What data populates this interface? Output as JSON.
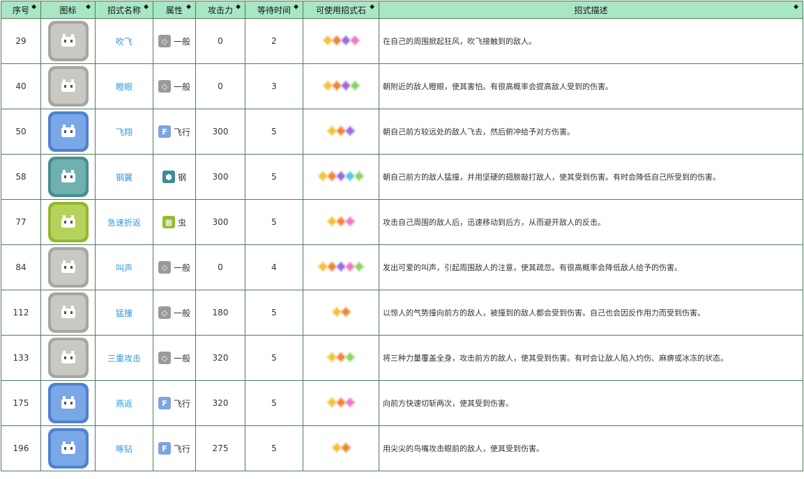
{
  "headers": [
    "序号",
    "图标",
    "招式名称",
    "属性",
    "攻击力",
    "等待时间",
    "可使用招式石",
    "招式描述"
  ],
  "sort_glyph": "◆",
  "rows": [
    {
      "id": "29",
      "name": "吹飞",
      "attr": "一般",
      "attr_type": "normal",
      "atk": "0",
      "wait": "2",
      "stones": [
        "#f2c43d",
        "#f0883a",
        "#9b6ee0",
        "#ee7cc8"
      ],
      "icon": "general",
      "desc": "在自己的周围掀起狂风，吹飞接触到的敌人。"
    },
    {
      "id": "40",
      "name": "瞪眼",
      "attr": "一般",
      "attr_type": "normal",
      "atk": "0",
      "wait": "3",
      "stones": [
        "#f2c43d",
        "#f0883a",
        "#9b6ee0",
        "#8fd46a"
      ],
      "icon": "general",
      "desc": "朝附近的敌人瞪眼，使其害怕。有很高概率会提高敌人受到的伤害。"
    },
    {
      "id": "50",
      "name": "飞翔",
      "attr": "飞行",
      "attr_type": "flying",
      "atk": "300",
      "wait": "5",
      "stones": [
        "#f2c43d",
        "#f0883a",
        "#9b6ee0"
      ],
      "icon": "flying",
      "desc": "朝自己前方较远处的敌人飞去，然后俯冲给予对方伤害。"
    },
    {
      "id": "58",
      "name": "钢翼",
      "attr": "钢",
      "attr_type": "steel",
      "atk": "300",
      "wait": "5",
      "stones": [
        "#f2c43d",
        "#f0883a",
        "#9b6ee0",
        "#5cc8e0",
        "#8fd46a"
      ],
      "icon": "steel",
      "desc": "朝自己前方的敌人猛撞，并用坚硬的翅膀敲打敌人，使其受到伤害。有时会降低自己所受到的伤害。"
    },
    {
      "id": "77",
      "name": "急速折返",
      "attr": "虫",
      "attr_type": "bug",
      "atk": "300",
      "wait": "5",
      "stones": [
        "#f2c43d",
        "#f0883a",
        "#ee7cc8"
      ],
      "icon": "bug",
      "desc": "攻击自己周围的敌人后，迅速移动到后方，从而避开敌人的反击。"
    },
    {
      "id": "84",
      "name": "叫声",
      "attr": "一般",
      "attr_type": "normal",
      "atk": "0",
      "wait": "4",
      "stones": [
        "#f2c43d",
        "#f0883a",
        "#9b6ee0",
        "#ee7cc8",
        "#8fd46a"
      ],
      "icon": "general",
      "desc": "发出可爱的叫声，引起周围敌人的注意，使其疏忽。有很高概率会降低敌人给予的伤害。"
    },
    {
      "id": "112",
      "name": "猛撞",
      "attr": "一般",
      "attr_type": "normal",
      "atk": "180",
      "wait": "5",
      "stones": [
        "#f2c43d",
        "#f0883a"
      ],
      "icon": "general",
      "desc": "以惊人的气势撞向前方的敌人，被撞到的敌人都会受到伤害。自己也会因反作用力而受到伤害。"
    },
    {
      "id": "133",
      "name": "三重攻击",
      "attr": "一般",
      "attr_type": "normal",
      "atk": "320",
      "wait": "5",
      "stones": [
        "#f2c43d",
        "#f0883a",
        "#8fd46a"
      ],
      "icon": "general",
      "desc": "将三种力量覆盖全身，攻击前方的敌人，使其受到伤害。有时会让敌人陷入灼伤、麻痹或冰冻的状态。"
    },
    {
      "id": "175",
      "name": "燕返",
      "attr": "飞行",
      "attr_type": "flying",
      "atk": "320",
      "wait": "5",
      "stones": [
        "#f2c43d",
        "#f0883a",
        "#ee7cc8"
      ],
      "icon": "flying",
      "desc": "向前方快速切斩两次，使其受到伤害。"
    },
    {
      "id": "196",
      "name": "啄钻",
      "attr": "飞行",
      "attr_type": "flying",
      "atk": "275",
      "wait": "5",
      "stones": [
        "#f2c43d",
        "#f0883a"
      ],
      "icon": "flying",
      "desc": "用尖尖的鸟嘴攻击眼前的敌人，使其受到伤害。"
    }
  ],
  "icon_colors": {
    "general": {
      "outer": "#a6a6a2",
      "inner": "#c9c9c4"
    },
    "flying": {
      "outer": "#4f82cf",
      "inner": "#7aa7e6"
    },
    "steel": {
      "outer": "#4a8e8f",
      "inner": "#6fb1b0"
    },
    "bug": {
      "outer": "#93b82e",
      "inner": "#b5d35a"
    }
  },
  "attr_colors": {
    "normal": "#9a9a9a",
    "flying": "#7da4e0",
    "steel": "#3f8a9a",
    "bug": "#97bc32"
  },
  "attr_glyphs": {
    "normal": "◇",
    "flying": "F",
    "steel": "⬢",
    "bug": "▦"
  }
}
